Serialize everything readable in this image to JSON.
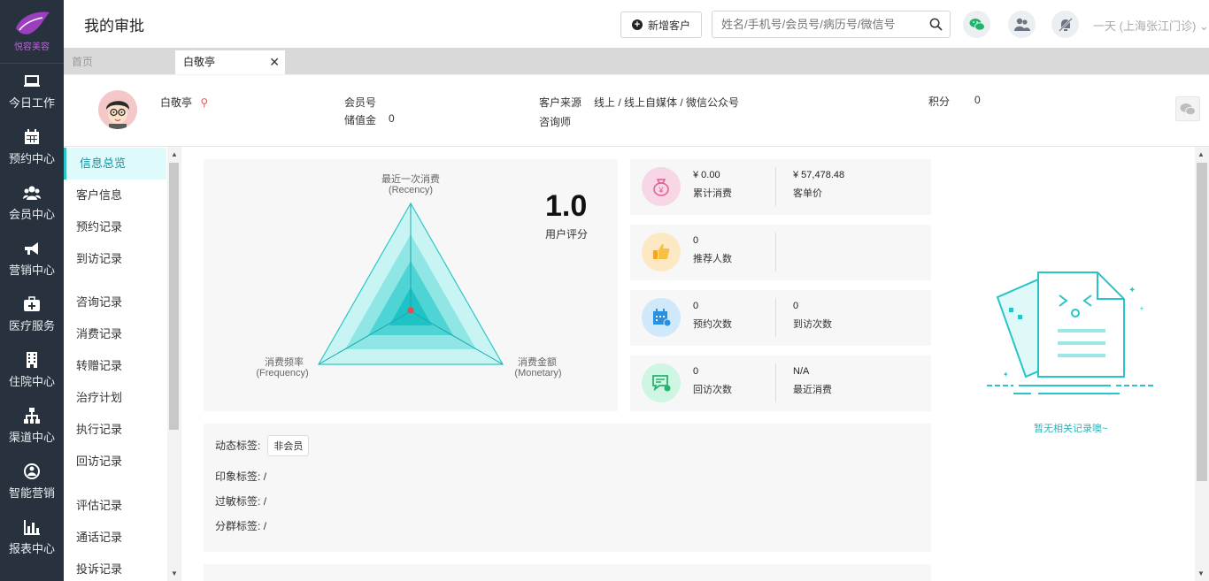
{
  "brand": {
    "name": "悦容美容",
    "accent": "#27c4c8",
    "nav_bg": "#27323e"
  },
  "nav": [
    {
      "label": "今日工作",
      "icon": "laptop-icon"
    },
    {
      "label": "预约中心",
      "icon": "calendar-icon"
    },
    {
      "label": "会员中心",
      "icon": "users-icon"
    },
    {
      "label": "营销中心",
      "icon": "megaphone-icon"
    },
    {
      "label": "医疗服务",
      "icon": "medkit-icon"
    },
    {
      "label": "住院中心",
      "icon": "building-icon"
    },
    {
      "label": "渠道中心",
      "icon": "sitemap-icon"
    },
    {
      "label": "智能营销",
      "icon": "brain-icon"
    },
    {
      "label": "报表中心",
      "icon": "bar-chart-icon"
    }
  ],
  "header": {
    "title": "我的审批",
    "add_customer": "新增客户",
    "search_placeholder": "姓名/手机号/会员号/病历号/微信号",
    "store": "一天 (上海张江门诊)"
  },
  "tabs": {
    "home": "首页",
    "active": "白敬亭",
    "close": "✕"
  },
  "customer": {
    "name": "白敬亭",
    "member_no_label": "会员号",
    "balance_label": "储值金",
    "balance": "0",
    "source_label": "客户来源",
    "source": "线上 / 线上自媒体 / 微信公众号",
    "consultant_label": "咨询师",
    "points_label": "积分",
    "points": "0"
  },
  "submenu": [
    "信息总览",
    "客户信息",
    "预约记录",
    "到访记录",
    "咨询记录",
    "消费记录",
    "转赠记录",
    "治疗计划",
    "执行记录",
    "回访记录",
    "评估记录",
    "通话记录",
    "投诉记录"
  ],
  "radar": {
    "recency_cn": "最近一次消费",
    "recency_en": "(Recency)",
    "frequency_cn": "消费频率",
    "frequency_en": "(Frequency)",
    "monetary_cn": "消费金额",
    "monetary_en": "(Monetary)",
    "score": "1.0",
    "score_label": "用户评分"
  },
  "stats": [
    {
      "icon": "money-bag-icon",
      "color": "#f7d6e6",
      "left_value": "¥ 0.00",
      "left_label": "累计消费",
      "right_value": "¥ 57,478.48",
      "right_label": "客单价"
    },
    {
      "icon": "thumbs-up-icon",
      "color": "#fde8c4",
      "left_value": "0",
      "left_label": "推荐人数",
      "right_value": "",
      "right_label": ""
    },
    {
      "icon": "calendar-check-icon",
      "color": "#cfe8fa",
      "left_value": "0",
      "left_label": "预约次数",
      "right_value": "0",
      "right_label": "到访次数"
    },
    {
      "icon": "chat-icon",
      "color": "#cff5e3",
      "left_value": "0",
      "left_label": "回访次数",
      "right_value": "N/A",
      "right_label": "最近消费"
    }
  ],
  "tags": {
    "dynamic_label": "动态标签:",
    "dynamic_value": "非会员",
    "impression_label": "印象标签:",
    "impression_value": "/",
    "allergy_label": "过敏标签:",
    "allergy_value": "/",
    "group_label": "分群标签:",
    "group_value": "/"
  },
  "empty_text": "暂无相关记录噢~"
}
